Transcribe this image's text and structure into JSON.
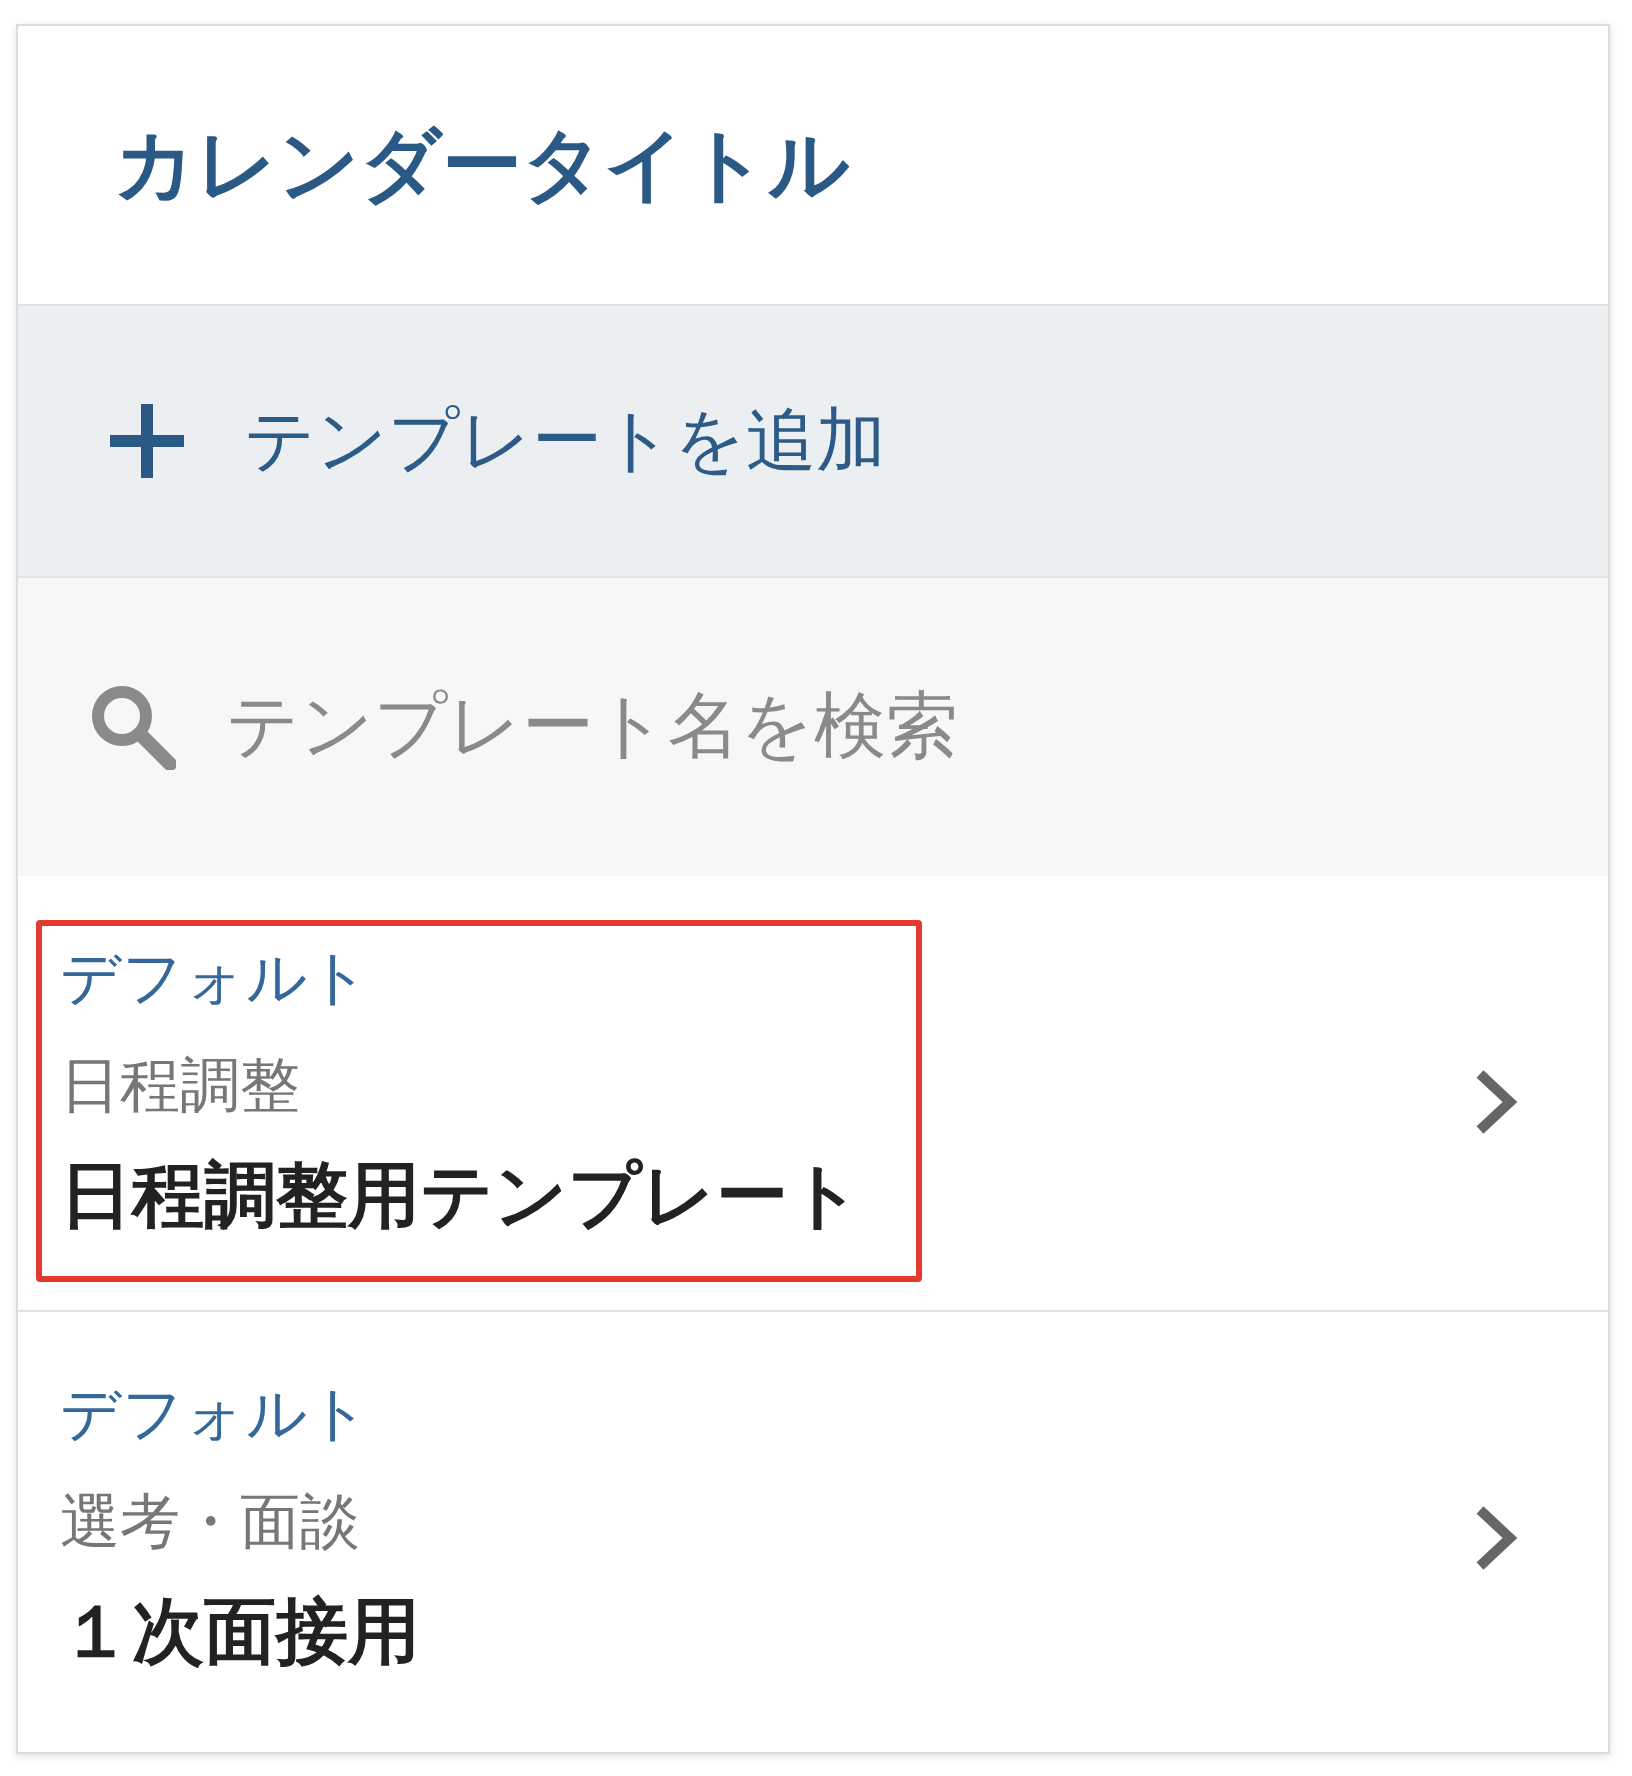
{
  "header": {
    "title": "カレンダータイトル"
  },
  "add_button": {
    "label": "テンプレートを追加"
  },
  "search": {
    "placeholder": "テンプレート名を検索"
  },
  "templates": [
    {
      "tag": "デフォルト",
      "category": "日程調整",
      "name": "日程調整用テンプレート",
      "highlighted": true
    },
    {
      "tag": "デフォルト",
      "category": "選考・面談",
      "name": "１次面接用",
      "highlighted": false
    }
  ]
}
